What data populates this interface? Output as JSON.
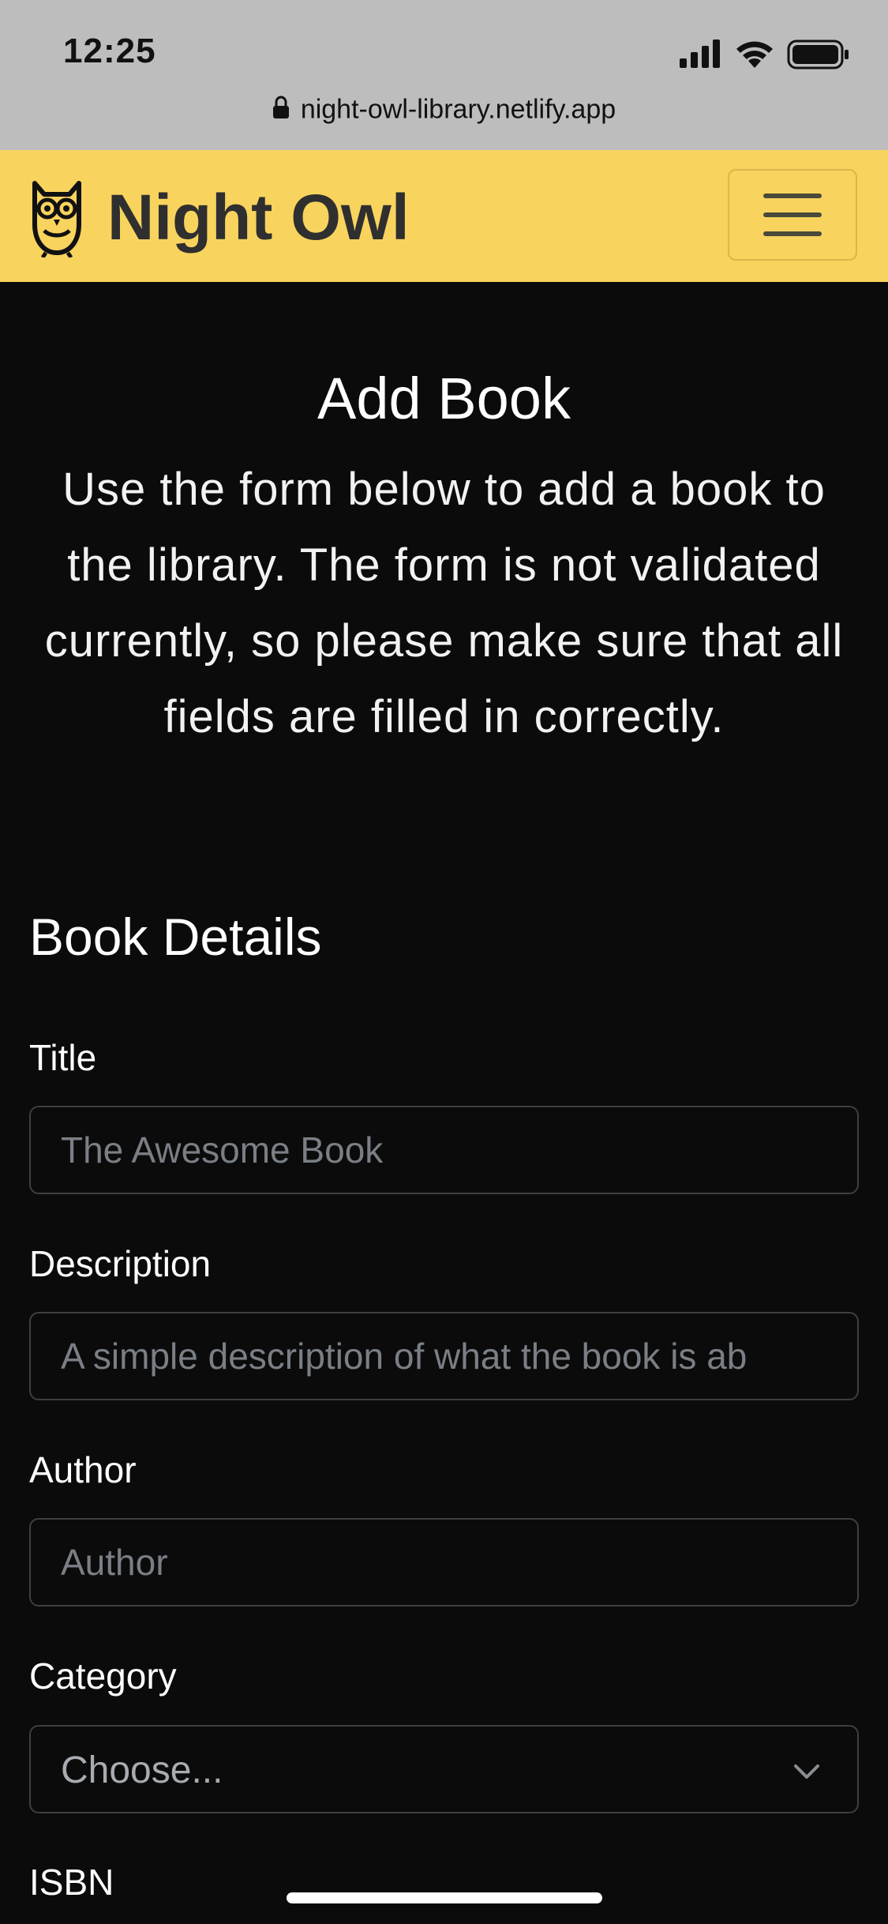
{
  "status_bar": {
    "time": "12:25"
  },
  "browser": {
    "url": "night-owl-library.netlify.app"
  },
  "navbar": {
    "brand": "Night Owl",
    "brand_color": "#f8d35e"
  },
  "hero": {
    "title": "Add Book",
    "intro": "Use the form below to add a book to the library. The form is not validated currently, so please make sure that all fields are filled in correctly."
  },
  "form": {
    "section_title": "Book Details",
    "title": {
      "label": "Title",
      "placeholder": "The Awesome Book"
    },
    "description": {
      "label": "Description",
      "placeholder": "A simple description of what the book is ab"
    },
    "author": {
      "label": "Author",
      "placeholder": "Author"
    },
    "category": {
      "label": "Category",
      "selected": "Choose..."
    },
    "isbn": {
      "label": "ISBN"
    }
  },
  "colors": {
    "background": "#0b0b0b",
    "accent": "#f8d35e",
    "input_border": "#3f3f3f",
    "placeholder": "#7a7f86"
  }
}
